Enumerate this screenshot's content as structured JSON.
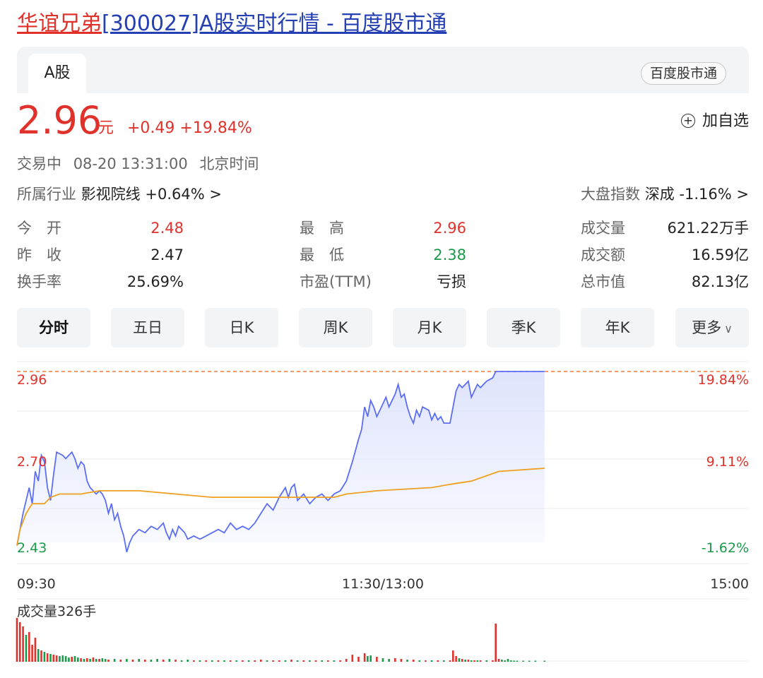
{
  "page_title": {
    "name_part": "华谊兄弟",
    "rest_part": "[300027]A股实时行情 - 百度股市通"
  },
  "tabs": {
    "active": "A股",
    "source_pill": "百度股市通"
  },
  "quote": {
    "price": "2.96",
    "unit": "元",
    "change": "+0.49",
    "change_pct": "+19.84%",
    "watch_label": "加自选",
    "watch_icon": "plus-circle-icon"
  },
  "status": {
    "state": "交易中",
    "datetime": "08-20 13:31:00",
    "zone": "北京时间"
  },
  "industry": {
    "label": "所属行业",
    "name": "影视院线",
    "pct": "+0.64%",
    "arrow": ">"
  },
  "market_index": {
    "label": "大盘指数",
    "name": "深成",
    "pct": "-1.16%",
    "arrow": ">"
  },
  "stats": {
    "open": {
      "label": "今　开",
      "value": "2.48"
    },
    "prev_close": {
      "label": "昨　收",
      "value": "2.47"
    },
    "turnover_rate": {
      "label": "换手率",
      "value": "25.69%"
    },
    "high": {
      "label": "最　高",
      "value": "2.96"
    },
    "low": {
      "label": "最　低",
      "value": "2.38"
    },
    "pe": {
      "label": "市盈(TTM)",
      "value": "亏损"
    },
    "volume": {
      "label": "成交量",
      "value": "621.22万手"
    },
    "amount": {
      "label": "成交额",
      "value": "16.59亿"
    },
    "market_cap": {
      "label": "总市值",
      "value": "82.13亿"
    }
  },
  "periods": {
    "items": [
      "分时",
      "五日",
      "日K",
      "周K",
      "月K",
      "季K",
      "年K"
    ],
    "more": "更多",
    "active_index": 0
  },
  "colors": {
    "up": "#e0322b",
    "down": "#1a9a4a",
    "price_line": "#5b6ef5",
    "avg_line": "#f0a020",
    "area_fill": "#dfe4fc"
  },
  "chart_data": {
    "type": "line",
    "x_ticks": [
      "09:30",
      "11:30/13:00",
      "15:00"
    ],
    "y_left_ticks": [
      "2.96",
      "2.70",
      "2.43"
    ],
    "y_right_ticks": [
      "19.84%",
      "9.11%",
      "-1.62%"
    ],
    "ylim": [
      2.43,
      2.96
    ],
    "session_minutes": 240,
    "volume_label": "成交量326手",
    "price_series": [
      [
        0,
        2.42
      ],
      [
        2,
        2.52
      ],
      [
        4,
        2.6
      ],
      [
        5,
        2.55
      ],
      [
        6,
        2.65
      ],
      [
        7,
        2.62
      ],
      [
        8,
        2.7
      ],
      [
        9,
        2.68
      ],
      [
        10,
        2.6
      ],
      [
        11,
        2.56
      ],
      [
        12,
        2.64
      ],
      [
        13,
        2.71
      ],
      [
        15,
        2.7
      ],
      [
        16,
        2.69
      ],
      [
        17,
        2.7
      ],
      [
        18,
        2.71
      ],
      [
        19,
        2.69
      ],
      [
        20,
        2.66
      ],
      [
        21,
        2.68
      ],
      [
        22,
        2.67
      ],
      [
        23,
        2.62
      ],
      [
        24,
        2.6
      ],
      [
        25,
        2.59
      ],
      [
        26,
        2.58
      ],
      [
        27,
        2.59
      ],
      [
        28,
        2.58
      ],
      [
        29,
        2.56
      ],
      [
        30,
        2.52
      ],
      [
        31,
        2.55
      ],
      [
        32,
        2.5
      ],
      [
        33,
        2.52
      ],
      [
        34,
        2.48
      ],
      [
        35,
        2.45
      ],
      [
        36,
        2.4
      ],
      [
        37,
        2.43
      ],
      [
        38,
        2.45
      ],
      [
        40,
        2.47
      ],
      [
        42,
        2.46
      ],
      [
        44,
        2.48
      ],
      [
        46,
        2.47
      ],
      [
        48,
        2.49
      ],
      [
        49,
        2.46
      ],
      [
        50,
        2.44
      ],
      [
        51,
        2.47
      ],
      [
        52,
        2.45
      ],
      [
        53,
        2.48
      ],
      [
        54,
        2.47
      ],
      [
        55,
        2.46
      ],
      [
        56,
        2.44
      ],
      [
        58,
        2.45
      ],
      [
        60,
        2.44
      ],
      [
        62,
        2.45
      ],
      [
        64,
        2.46
      ],
      [
        66,
        2.47
      ],
      [
        68,
        2.46
      ],
      [
        70,
        2.49
      ],
      [
        72,
        2.47
      ],
      [
        74,
        2.48
      ],
      [
        76,
        2.47
      ],
      [
        78,
        2.49
      ],
      [
        80,
        2.52
      ],
      [
        82,
        2.55
      ],
      [
        84,
        2.53
      ],
      [
        86,
        2.57
      ],
      [
        88,
        2.6
      ],
      [
        89,
        2.57
      ],
      [
        90,
        2.6
      ],
      [
        91,
        2.61
      ],
      [
        92,
        2.56
      ],
      [
        94,
        2.58
      ],
      [
        96,
        2.55
      ],
      [
        98,
        2.57
      ],
      [
        100,
        2.58
      ],
      [
        102,
        2.56
      ],
      [
        104,
        2.58
      ],
      [
        106,
        2.59
      ],
      [
        108,
        2.62
      ],
      [
        110,
        2.68
      ],
      [
        112,
        2.75
      ],
      [
        113,
        2.78
      ],
      [
        114,
        2.85
      ],
      [
        115,
        2.82
      ],
      [
        116,
        2.87
      ],
      [
        117,
        2.85
      ],
      [
        118,
        2.82
      ],
      [
        120,
        2.86
      ],
      [
        121,
        2.88
      ],
      [
        122,
        2.85
      ],
      [
        124,
        2.89
      ],
      [
        125,
        2.92
      ],
      [
        126,
        2.88
      ],
      [
        127,
        2.89
      ],
      [
        128,
        2.85
      ],
      [
        129,
        2.82
      ],
      [
        130,
        2.8
      ],
      [
        131,
        2.84
      ],
      [
        132,
        2.82
      ],
      [
        133,
        2.85
      ],
      [
        135,
        2.84
      ],
      [
        136,
        2.81
      ],
      [
        137,
        2.83
      ],
      [
        138,
        2.81
      ],
      [
        139,
        2.82
      ],
      [
        140,
        2.8
      ],
      [
        142,
        2.8
      ],
      [
        143,
        2.85
      ],
      [
        144,
        2.9
      ],
      [
        145,
        2.92
      ],
      [
        146,
        2.91
      ],
      [
        147,
        2.92
      ],
      [
        148,
        2.93
      ],
      [
        149,
        2.88
      ],
      [
        150,
        2.9
      ],
      [
        151,
        2.92
      ],
      [
        152,
        2.91
      ],
      [
        154,
        2.93
      ],
      [
        156,
        2.94
      ],
      [
        157,
        2.96
      ],
      [
        159,
        2.96
      ],
      [
        173,
        2.96
      ]
    ],
    "avg_series": [
      [
        0,
        2.42
      ],
      [
        1,
        2.47
      ],
      [
        3,
        2.52
      ],
      [
        5,
        2.55
      ],
      [
        9,
        2.55
      ],
      [
        11,
        2.57
      ],
      [
        14,
        2.58
      ],
      [
        21,
        2.58
      ],
      [
        27,
        2.59
      ],
      [
        40,
        2.59
      ],
      [
        64,
        2.57
      ],
      [
        104,
        2.57
      ],
      [
        108,
        2.58
      ],
      [
        118,
        2.59
      ],
      [
        136,
        2.6
      ],
      [
        142,
        2.61
      ],
      [
        149,
        2.62
      ],
      [
        158,
        2.65
      ],
      [
        173,
        2.66
      ]
    ],
    "volume_series": [
      [
        0,
        310,
        "r"
      ],
      [
        1,
        280,
        "r"
      ],
      [
        2,
        250,
        "r"
      ],
      [
        3,
        190,
        "g"
      ],
      [
        4,
        210,
        "r"
      ],
      [
        5,
        120,
        "r"
      ],
      [
        6,
        170,
        "r"
      ],
      [
        7,
        90,
        "g"
      ],
      [
        8,
        80,
        "r"
      ],
      [
        9,
        70,
        "g"
      ],
      [
        10,
        60,
        "r"
      ],
      [
        11,
        55,
        "g"
      ],
      [
        12,
        50,
        "r"
      ],
      [
        13,
        45,
        "r"
      ],
      [
        14,
        40,
        "g"
      ],
      [
        15,
        45,
        "g"
      ],
      [
        16,
        40,
        "g"
      ],
      [
        17,
        30,
        "g"
      ],
      [
        18,
        35,
        "r"
      ],
      [
        19,
        40,
        "g"
      ],
      [
        20,
        30,
        "g"
      ],
      [
        21,
        25,
        "r"
      ],
      [
        22,
        20,
        "g"
      ],
      [
        23,
        25,
        "r"
      ],
      [
        24,
        20,
        "g"
      ],
      [
        25,
        30,
        "r"
      ],
      [
        26,
        20,
        "g"
      ],
      [
        27,
        20,
        "r"
      ],
      [
        28,
        25,
        "g"
      ],
      [
        29,
        20,
        "g"
      ],
      [
        30,
        15,
        "r"
      ],
      [
        32,
        20,
        "g"
      ],
      [
        34,
        15,
        "r"
      ],
      [
        36,
        20,
        "g"
      ],
      [
        38,
        15,
        "r"
      ],
      [
        40,
        20,
        "g"
      ],
      [
        42,
        15,
        "r"
      ],
      [
        44,
        15,
        "g"
      ],
      [
        46,
        20,
        "g"
      ],
      [
        48,
        15,
        "r"
      ],
      [
        50,
        20,
        "g"
      ],
      [
        52,
        15,
        "r"
      ],
      [
        54,
        10,
        "g"
      ],
      [
        56,
        15,
        "g"
      ],
      [
        58,
        10,
        "r"
      ],
      [
        60,
        10,
        "g"
      ],
      [
        62,
        10,
        "r"
      ],
      [
        64,
        10,
        "g"
      ],
      [
        66,
        10,
        "r"
      ],
      [
        68,
        10,
        "g"
      ],
      [
        70,
        10,
        "r"
      ],
      [
        72,
        10,
        "g"
      ],
      [
        74,
        10,
        "r"
      ],
      [
        76,
        10,
        "g"
      ],
      [
        78,
        10,
        "r"
      ],
      [
        80,
        15,
        "r"
      ],
      [
        82,
        10,
        "g"
      ],
      [
        84,
        10,
        "r"
      ],
      [
        86,
        10,
        "r"
      ],
      [
        88,
        10,
        "g"
      ],
      [
        90,
        15,
        "r"
      ],
      [
        92,
        10,
        "g"
      ],
      [
        94,
        10,
        "r"
      ],
      [
        96,
        10,
        "g"
      ],
      [
        98,
        10,
        "r"
      ],
      [
        100,
        10,
        "g"
      ],
      [
        102,
        10,
        "r"
      ],
      [
        104,
        10,
        "g"
      ],
      [
        106,
        10,
        "r"
      ],
      [
        108,
        20,
        "r"
      ],
      [
        110,
        50,
        "r"
      ],
      [
        112,
        35,
        "r"
      ],
      [
        114,
        60,
        "r"
      ],
      [
        115,
        40,
        "g"
      ],
      [
        116,
        45,
        "g"
      ],
      [
        118,
        35,
        "r"
      ],
      [
        120,
        25,
        "g"
      ],
      [
        122,
        20,
        "g"
      ],
      [
        124,
        25,
        "r"
      ],
      [
        126,
        20,
        "r"
      ],
      [
        128,
        15,
        "g"
      ],
      [
        130,
        15,
        "r"
      ],
      [
        132,
        10,
        "g"
      ],
      [
        134,
        10,
        "r"
      ],
      [
        136,
        10,
        "g"
      ],
      [
        138,
        10,
        "r"
      ],
      [
        140,
        10,
        "g"
      ],
      [
        142,
        10,
        "r"
      ],
      [
        143,
        80,
        "r"
      ],
      [
        144,
        40,
        "r"
      ],
      [
        145,
        25,
        "g"
      ],
      [
        146,
        20,
        "r"
      ],
      [
        147,
        15,
        "g"
      ],
      [
        148,
        15,
        "r"
      ],
      [
        149,
        10,
        "g"
      ],
      [
        150,
        10,
        "r"
      ],
      [
        151,
        10,
        "g"
      ],
      [
        152,
        10,
        "r"
      ],
      [
        154,
        10,
        "g"
      ],
      [
        156,
        10,
        "r"
      ],
      [
        157,
        270,
        "r"
      ],
      [
        158,
        20,
        "r"
      ],
      [
        159,
        15,
        "g"
      ],
      [
        160,
        10,
        "g"
      ],
      [
        161,
        20,
        "g"
      ],
      [
        162,
        10,
        "g"
      ],
      [
        163,
        8,
        "g"
      ],
      [
        164,
        5,
        "g"
      ],
      [
        166,
        5,
        "g"
      ],
      [
        168,
        4,
        "g"
      ],
      [
        170,
        4,
        "g"
      ],
      [
        173,
        4,
        "g"
      ]
    ]
  }
}
